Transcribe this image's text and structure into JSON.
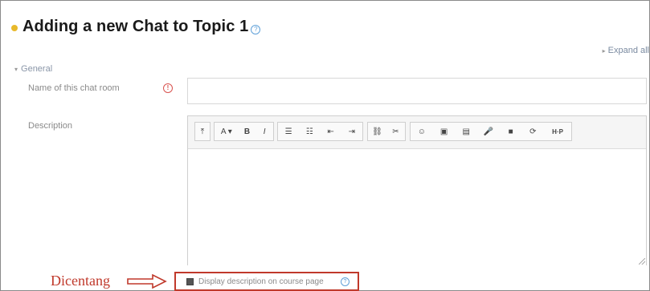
{
  "page": {
    "title": "Adding a new Chat to Topic 1",
    "expand_all": "Expand all"
  },
  "section": {
    "general": "General"
  },
  "fields": {
    "name_label": "Name of this chat room",
    "name_value": "",
    "required_icon": "!",
    "description_label": "Description"
  },
  "toolbar": {
    "groups": [
      [
        {
          "icon": "expand-icon",
          "glyph": "⤒"
        }
      ],
      [
        {
          "icon": "font-color-icon",
          "glyph": "A ▾"
        },
        {
          "icon": "bold-icon",
          "glyph": "B"
        },
        {
          "icon": "italic-icon",
          "glyph": "I"
        }
      ],
      [
        {
          "icon": "unordered-list-icon",
          "glyph": "☰"
        },
        {
          "icon": "ordered-list-icon",
          "glyph": "☷"
        },
        {
          "icon": "outdent-icon",
          "glyph": "⇤"
        },
        {
          "icon": "indent-icon",
          "glyph": "⇥"
        }
      ],
      [
        {
          "icon": "link-icon",
          "glyph": "⛓"
        },
        {
          "icon": "unlink-icon",
          "glyph": "✂"
        }
      ],
      [
        {
          "icon": "emoji-icon",
          "glyph": "☺"
        },
        {
          "icon": "image-icon",
          "glyph": "▣"
        },
        {
          "icon": "media-icon",
          "glyph": "▤"
        },
        {
          "icon": "record-audio-icon",
          "glyph": "🎤"
        },
        {
          "icon": "record-video-icon",
          "glyph": "■"
        },
        {
          "icon": "manage-files-icon",
          "glyph": "⟳"
        },
        {
          "icon": "h5p-icon",
          "glyph": "H·P"
        }
      ]
    ]
  },
  "display_description": {
    "label": "Display description on course page",
    "checked": true
  },
  "annotation": {
    "label": "Dicentang"
  },
  "colors": {
    "accent_red": "#c0392b",
    "help_blue": "#5fa0d8",
    "title_dot": "#e8b92b"
  }
}
